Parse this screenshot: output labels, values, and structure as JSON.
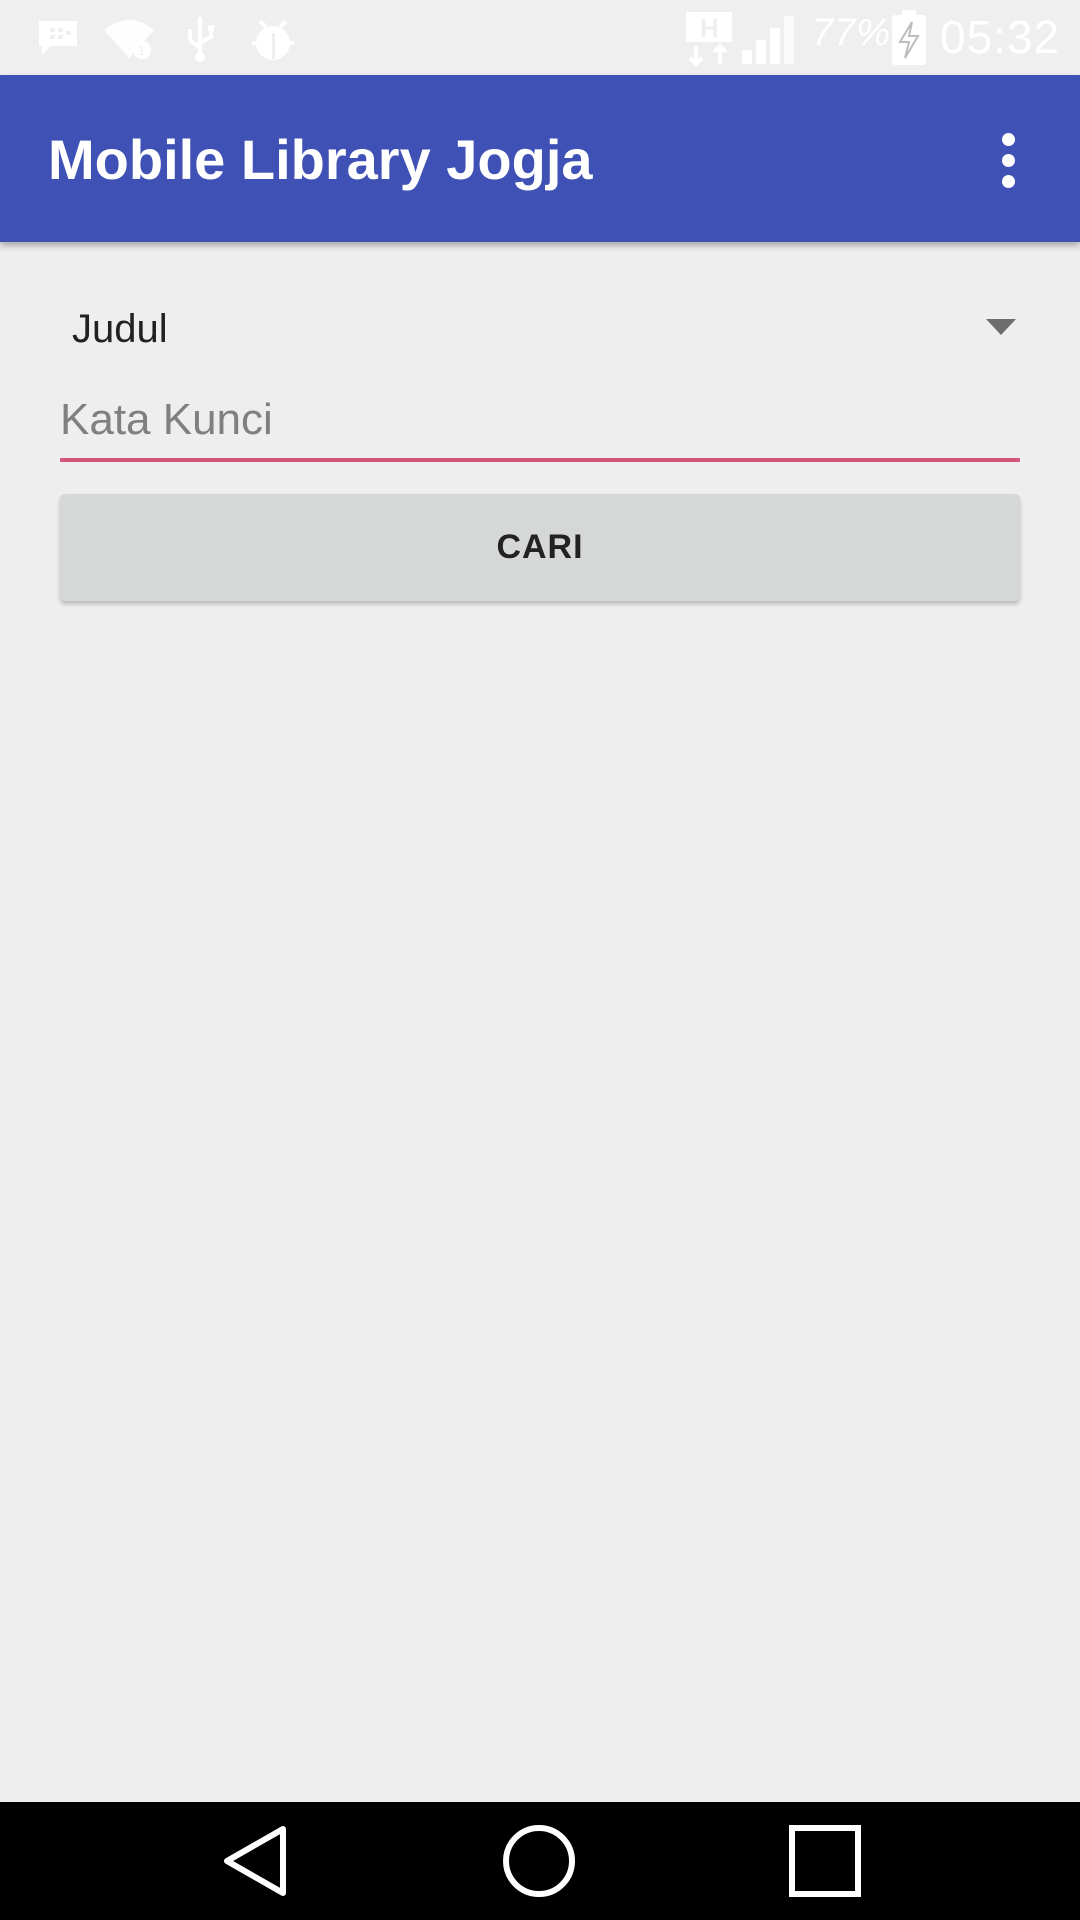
{
  "status_bar": {
    "icons": [
      "bbm-message-icon",
      "wifi-icon",
      "usb-icon",
      "android-debug-icon",
      "h-data-icon",
      "signal-icon",
      "battery-charging-icon"
    ],
    "battery_percent": "77%",
    "time": "05:32"
  },
  "app_bar": {
    "title": "Mobile Library Jogja",
    "overflow_icon": "more-vert-icon"
  },
  "search_form": {
    "category_selected": "Judul",
    "keyword_placeholder": "Kata Kunci",
    "keyword_value": "",
    "accent_color": "#d4547a",
    "search_button_label": "CARI"
  },
  "nav_bar": {
    "buttons": [
      "back-icon",
      "home-icon",
      "recents-icon"
    ]
  },
  "colors": {
    "primary": "#3f51b5",
    "background": "#eeeeee",
    "button": "#d6d7d7"
  }
}
